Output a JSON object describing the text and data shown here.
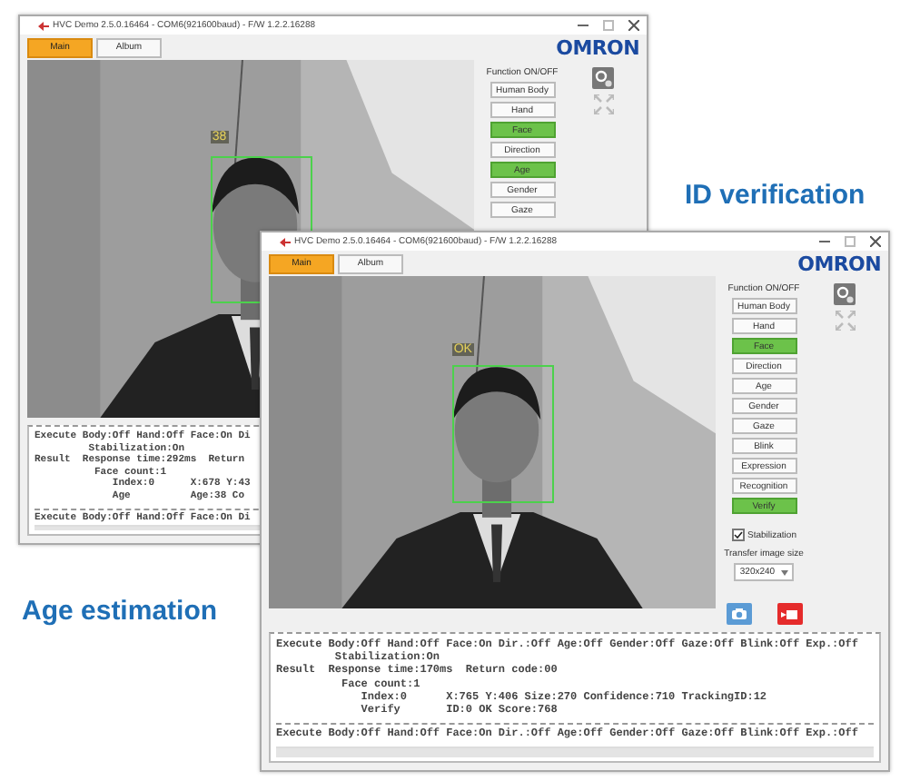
{
  "windows": [
    {
      "title": "HVC Demo 2.5.0.16464 - COM6(921600baud) - F/W 1.2.2.16288",
      "tabs": [
        {
          "label": "Main",
          "selected": true
        },
        {
          "label": "Album",
          "selected": false
        }
      ],
      "logo": "OMRON",
      "camera": {
        "tag": "38"
      },
      "functions": {
        "heading": "Function ON/OFF",
        "buttons": [
          {
            "label": "Human Body",
            "on": false
          },
          {
            "label": "Hand",
            "on": false
          },
          {
            "label": "Face",
            "on": true
          },
          {
            "label": "Direction",
            "on": false
          },
          {
            "label": "Age",
            "on": true
          },
          {
            "label": "Gender",
            "on": false
          },
          {
            "label": "Gaze",
            "on": false
          }
        ]
      },
      "log": [
        {
          "kind": "head",
          "text": "Execute Body:Off Hand:Off Face:On Di"
        },
        {
          "kind": "sub",
          "text": "Stabilization:On"
        },
        {
          "kind": "head",
          "text": "Result  Response time:292ms  Return"
        },
        {
          "kind": "group",
          "text": "Face count:1"
        },
        {
          "kind": "item",
          "text": "Index:0      X:678 Y:43"
        },
        {
          "kind": "item",
          "text": "Age          Age:38 Co"
        },
        {
          "kind": "rule"
        },
        {
          "kind": "head",
          "text": "Execute Body:Off Hand:Off Face:On Di"
        }
      ]
    },
    {
      "title": "HVC Demo 2.5.0.16464 - COM6(921600baud) - F/W 1.2.2.16288",
      "tabs": [
        {
          "label": "Main",
          "selected": true
        },
        {
          "label": "Album",
          "selected": false
        }
      ],
      "logo": "OMRON",
      "camera": {
        "tag": "OK"
      },
      "functions": {
        "heading": "Function ON/OFF",
        "buttons": [
          {
            "label": "Human Body",
            "on": false
          },
          {
            "label": "Hand",
            "on": false
          },
          {
            "label": "Face",
            "on": true
          },
          {
            "label": "Direction",
            "on": false
          },
          {
            "label": "Age",
            "on": false
          },
          {
            "label": "Gender",
            "on": false
          },
          {
            "label": "Gaze",
            "on": false
          },
          {
            "label": "Blink",
            "on": false
          },
          {
            "label": "Expression",
            "on": false
          },
          {
            "label": "Recognition",
            "on": false
          },
          {
            "label": "Verify",
            "on": true
          }
        ]
      },
      "stabilization": {
        "label": "Stabilization",
        "checked": true
      },
      "transfer": {
        "label": "Transfer image size",
        "value": "320x240"
      },
      "log": [
        {
          "kind": "head",
          "text": "Execute Body:Off Hand:Off Face:On Dir.:Off Age:Off Gender:Off Gaze:Off Blink:Off Exp.:Off"
        },
        {
          "kind": "sub",
          "text": "Stabilization:On"
        },
        {
          "kind": "head",
          "text": "Result  Response time:170ms  Return code:00"
        },
        {
          "kind": "group",
          "text": "Face count:1"
        },
        {
          "kind": "item",
          "text": "Index:0      X:765 Y:406 Size:270 Confidence:710 TrackingID:12"
        },
        {
          "kind": "item",
          "text": "Verify       ID:0 OK Score:768"
        },
        {
          "kind": "rule"
        },
        {
          "kind": "head",
          "text": "Execute Body:Off Hand:Off Face:On Dir.:Off Age:Off Gender:Off Gaze:Off Blink:Off Exp.:Off"
        }
      ]
    }
  ],
  "captions": [
    {
      "text": "Age estimation"
    },
    {
      "text": "ID verification"
    }
  ]
}
